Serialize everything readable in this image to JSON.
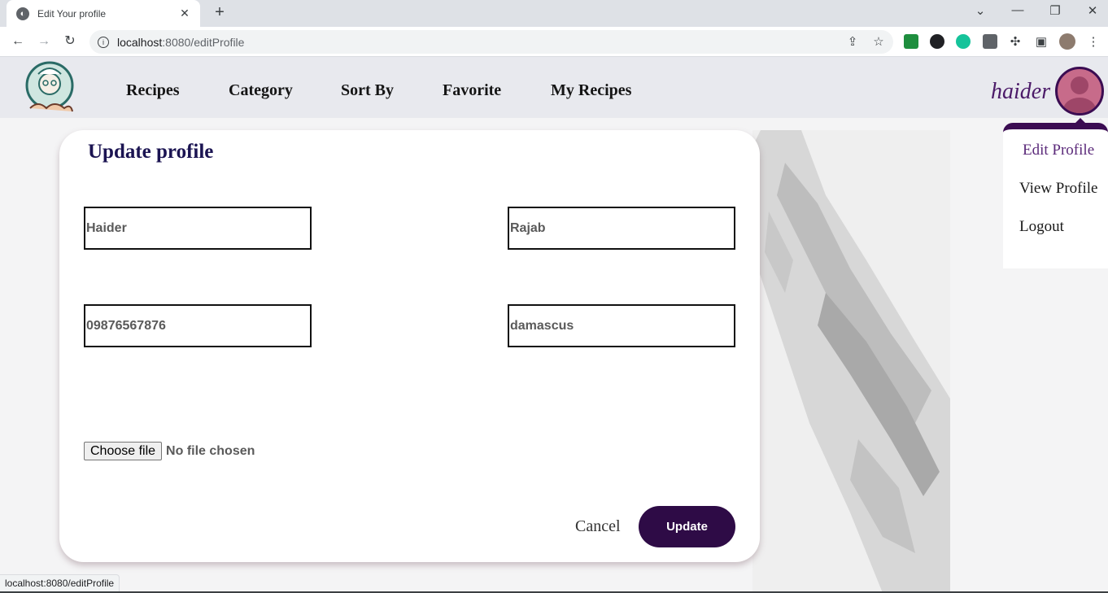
{
  "browser": {
    "tab_title": "Edit Your profile",
    "tab_close": "✕",
    "new_tab": "+",
    "url_host": "localhost",
    "url_rest": ":8080/editProfile",
    "window_controls": [
      "⌄",
      "—",
      "❐",
      "✕"
    ],
    "status_url": "localhost:8080/editProfile"
  },
  "header": {
    "nav": [
      "Recipes",
      "Category",
      "Sort By",
      "Favorite",
      "My Recipes"
    ],
    "username": "haider"
  },
  "dropdown": {
    "items": [
      "Edit Profile",
      "View Profile",
      "Logout"
    ]
  },
  "form": {
    "title": "Update profile",
    "first_name": "Haider",
    "last_name": "Rajab",
    "phone": "09876567876",
    "city": "damascus",
    "file_button": "Choose file",
    "file_status": "No file chosen",
    "cancel_label": "Cancel",
    "update_label": "Update"
  },
  "colors": {
    "accent": "#2e0b46",
    "title": "#1b1452",
    "username": "#4b1a68"
  }
}
